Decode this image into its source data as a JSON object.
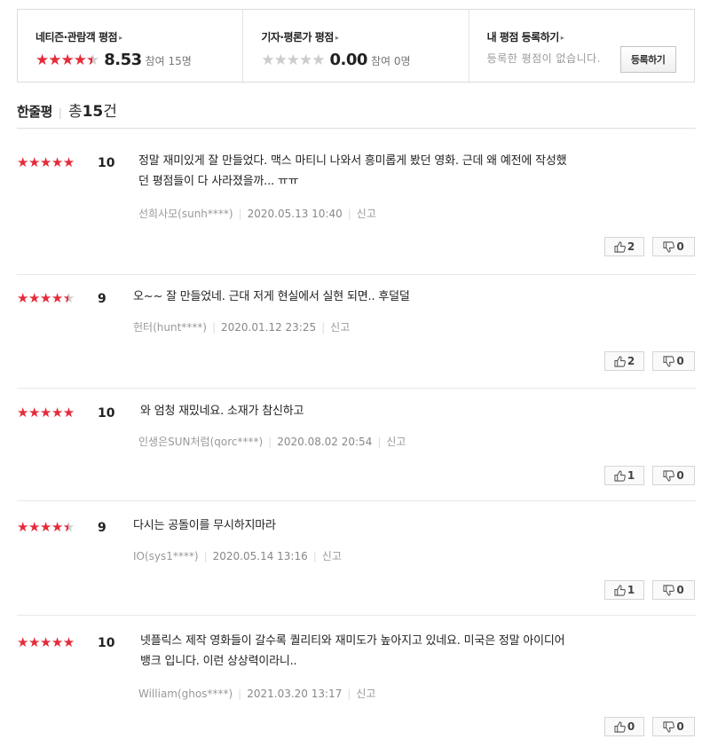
{
  "summary": {
    "netizen": {
      "title": "네티즌·관람객 평점",
      "arrow": "▸",
      "score": "8.53",
      "participants": "참여 15명",
      "stars_filled": 4.5
    },
    "critic": {
      "title": "기자·평론가 평점",
      "arrow": "▸",
      "score": "0.00",
      "participants": "참여 0명",
      "stars_filled": 0
    },
    "mine": {
      "title": "내 평점 등록하기",
      "arrow": "▸",
      "empty_message": "등록한 평점이 없습니다.",
      "register_label": "등록하기"
    }
  },
  "header": {
    "title": "한줄평",
    "separator": "|",
    "total_label": "총 ",
    "count": "15",
    "count_unit": "건"
  },
  "colors": {
    "star": "#e52b3a",
    "star_empty": "#cccccc"
  },
  "reviews": [
    {
      "rating": 5,
      "score": "10",
      "text_lines": [
        "정말 재미있게 잘 만들었다. 맥스 마티니 나와서 흥미롭게 봤던 영화. 근데 왜 예전에 작성했",
        "던 평점들이 다 사라졌을까... ㅠㅠ"
      ],
      "author": "선희사모(sunh****)",
      "date": "2020.05.13 10:40",
      "report": "신고",
      "likes": "2",
      "dislikes": "0"
    },
    {
      "rating": 4.5,
      "score": "9",
      "text_lines": [
        "오~~ 잘 만들었네. 근대 저게 현실에서 실현 되면.. 후덜덜"
      ],
      "author": "헌터(hunt****)",
      "date": "2020.01.12 23:25",
      "report": "신고",
      "likes": "2",
      "dislikes": "0"
    },
    {
      "rating": 5,
      "score": "10",
      "text_lines": [
        "와 엄청 재밌네요. 소재가 참신하고"
      ],
      "author": "인생은SUN처럼(qorc****)",
      "date": "2020.08.02 20:54",
      "report": "신고",
      "likes": "1",
      "dislikes": "0"
    },
    {
      "rating": 4.5,
      "score": "9",
      "text_lines": [
        "다시는 공돌이를 무시하지마라"
      ],
      "author": "IO(sys1****)",
      "date": "2020.05.14 13:16",
      "report": "신고",
      "likes": "1",
      "dislikes": "0"
    },
    {
      "rating": 5,
      "score": "10",
      "text_lines": [
        "넷플릭스 제작 영화들이 갈수록 퀄리티와 재미도가 높아지고 있네요. 미국은 정말 아이디어",
        "뱅크 입니다. 이런 상상력이라니.."
      ],
      "author": "William(ghos****)",
      "date": "2021.03.20 13:17",
      "report": "신고",
      "likes": "0",
      "dislikes": "0"
    }
  ]
}
